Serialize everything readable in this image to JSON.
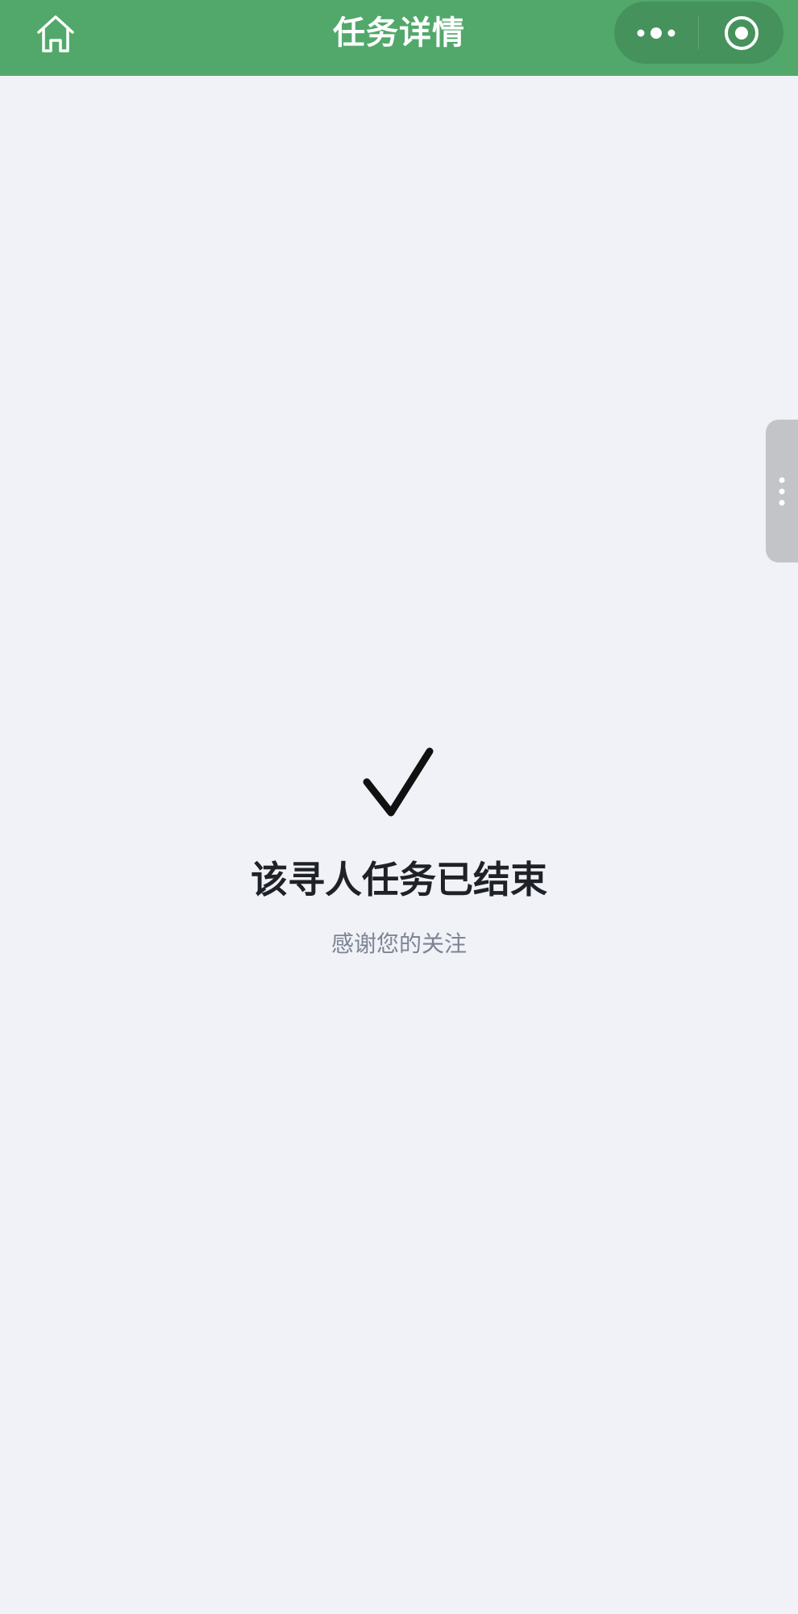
{
  "header": {
    "title": "任务详情",
    "bar_color": "#52a86a",
    "capsule_color": "#45925c",
    "icons": {
      "home": "home-icon",
      "more": "more-dots-icon",
      "close": "close-target-icon"
    }
  },
  "side_panel": {
    "icon": "vertical-dots-icon"
  },
  "result": {
    "icon": "checkmark-icon",
    "title": "该寻人任务已结束",
    "subtitle": "感谢您的关注"
  },
  "colors": {
    "background": "#f0f2f7",
    "title_text": "#1f2128",
    "subtitle_text": "#7e8494",
    "side_handle": "#c3c4c8"
  }
}
